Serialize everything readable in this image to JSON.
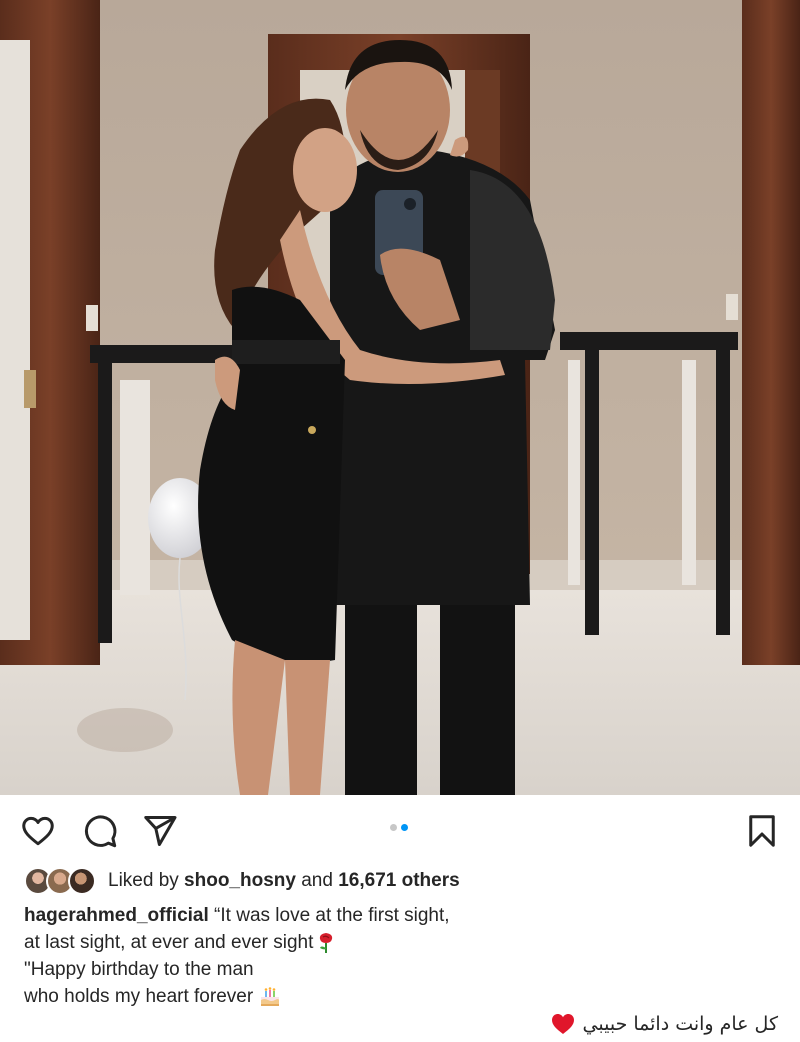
{
  "post": {
    "photo": {
      "alt_icon": "photo-couple-selfie"
    },
    "actions": {
      "like_icon": "heart-outline-icon",
      "comment_icon": "comment-bubble-icon",
      "share_icon": "paper-plane-icon",
      "save_icon": "bookmark-icon",
      "carousel": {
        "count": 2,
        "active_index": 1
      }
    },
    "likes": {
      "prefix": "Liked by ",
      "user": "shoo_hosny",
      "middle": " and ",
      "count": "16,671 others"
    },
    "caption": {
      "username": "hagerahmed_official",
      "line1": " “It was love at the first sight,",
      "line2": "at last sight, at ever and ever sight",
      "line3": "\"Happy birthday to the man",
      "line4": "who holds my heart forever",
      "arabic": "كل عام وانت دائما حبيبي"
    },
    "colors": {
      "accent_blue": "#0095f6",
      "text": "#262626",
      "heart_red": "#e0162b"
    }
  }
}
